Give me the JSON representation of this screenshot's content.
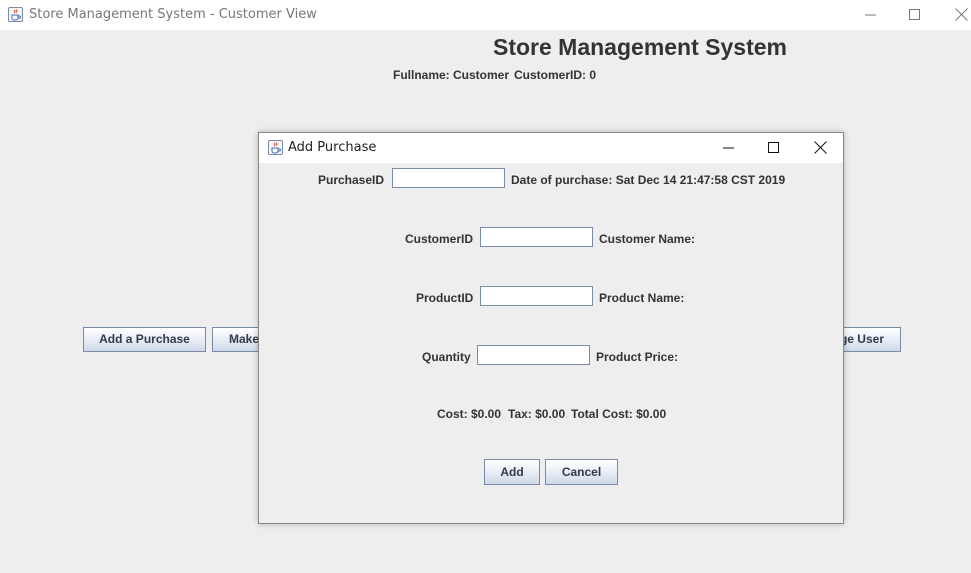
{
  "window": {
    "title": "Store Management System - Customer View"
  },
  "main": {
    "heading": "Store Management System",
    "fullname_label": "Fullname: Customer",
    "customer_id_label": "CustomerID: 0",
    "buttons": {
      "add_purchase": "Add a Purchase",
      "make_partial": "Make",
      "manage_user_partial": "ge User"
    }
  },
  "dialog": {
    "title": "Add Purchase",
    "purchase_id_label": "PurchaseID",
    "purchase_id_value": "",
    "date_label": "Date of purchase: Sat Dec 14 21:47:58 CST 2019",
    "customer_id_label": "CustomerID",
    "customer_id_value": "",
    "customer_name_label": "Customer Name:",
    "product_id_label": "ProductID",
    "product_id_value": "",
    "product_name_label": "Product Name:",
    "quantity_label": "Quantity",
    "quantity_value": "",
    "product_price_label": "Product Price:",
    "cost_label": "Cost: $0.00",
    "tax_label": "Tax: $0.00",
    "total_cost_label": "Total Cost: $0.00",
    "add_button": "Add",
    "cancel_button": "Cancel"
  },
  "icons": {
    "app_icon": "java-cup-icon",
    "minimize": "minimize-icon",
    "maximize": "maximize-icon",
    "close": "close-icon"
  }
}
